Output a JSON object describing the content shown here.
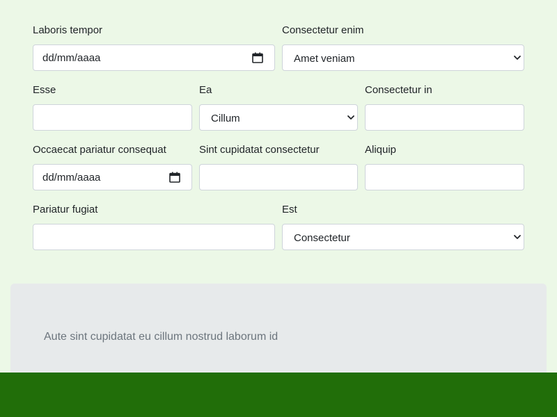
{
  "form": {
    "laboris_tempor": {
      "label": "Laboris tempor",
      "value": "dd/mm/aaaa"
    },
    "consectetur_enim": {
      "label": "Consectetur enim",
      "value": "Amet veniam"
    },
    "esse": {
      "label": "Esse",
      "value": ""
    },
    "ea": {
      "label": "Ea",
      "value": "Cillum"
    },
    "consectetur_in": {
      "label": "Consectetur in",
      "value": ""
    },
    "occaecat": {
      "label": "Occaecat pariatur consequat",
      "value": "dd/mm/aaaa"
    },
    "sint": {
      "label": "Sint cupidatat consectetur",
      "value": ""
    },
    "aliquip": {
      "label": "Aliquip",
      "value": ""
    },
    "pariatur_fugiat": {
      "label": "Pariatur fugiat",
      "value": ""
    },
    "est": {
      "label": "Est",
      "value": "Consectetur"
    }
  },
  "panel": {
    "text": "Aute sint cupidatat eu cillum nostrud laborum id"
  },
  "icons": {
    "date": "calendar-icon",
    "select": "chevron-down-icon"
  },
  "colors": {
    "page_bg": "#ecf8e7",
    "panel_bg": "#e7eaeb",
    "footer_bg": "#216e09",
    "input_border": "#ced4da"
  }
}
